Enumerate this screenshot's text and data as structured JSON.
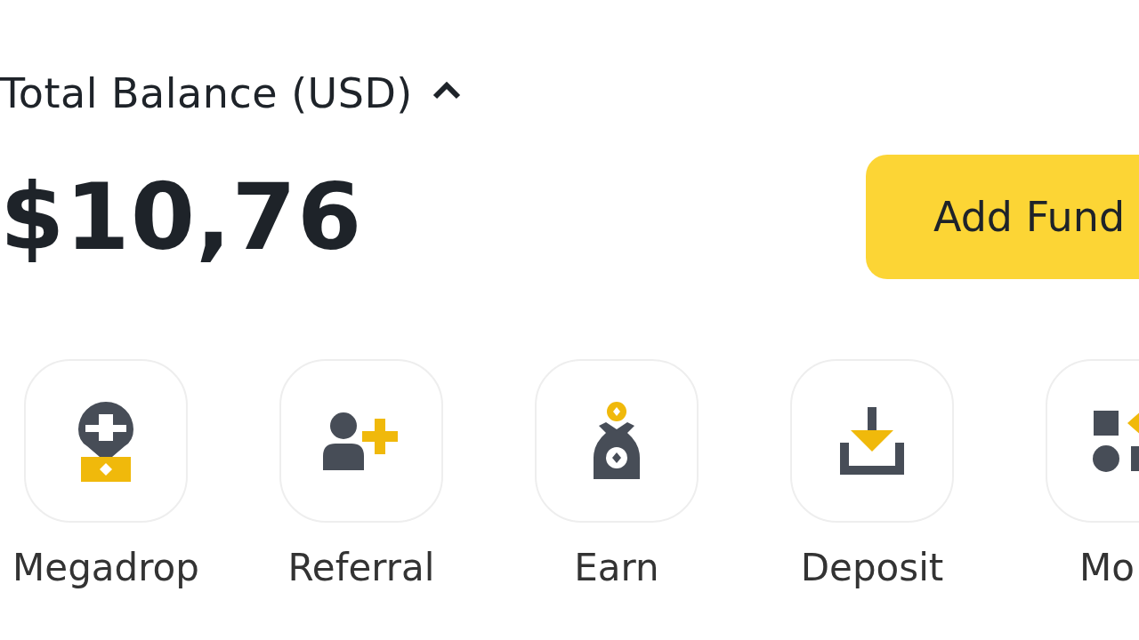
{
  "balance": {
    "label": "Total Balance (USD)",
    "expanded": true,
    "amount": "$10,76"
  },
  "add_funds_button": {
    "label": "Add Fund"
  },
  "shortcuts": [
    {
      "kind": "megadrop",
      "label": "Megadrop"
    },
    {
      "kind": "referral",
      "label": "Referral"
    },
    {
      "kind": "earn",
      "label": "Earn"
    },
    {
      "kind": "deposit",
      "label": "Deposit"
    },
    {
      "kind": "more",
      "label": "Mo"
    }
  ]
}
